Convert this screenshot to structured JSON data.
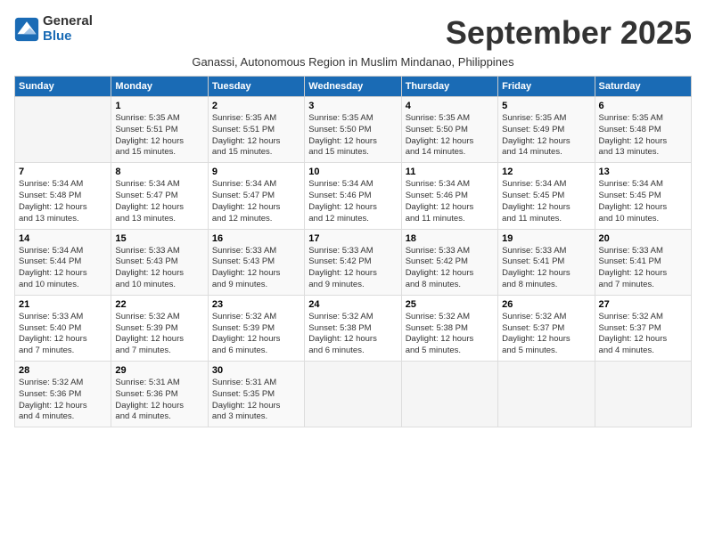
{
  "header": {
    "logo_line1": "General",
    "logo_line2": "Blue",
    "month_title": "September 2025",
    "subtitle": "Ganassi, Autonomous Region in Muslim Mindanao, Philippines"
  },
  "weekdays": [
    "Sunday",
    "Monday",
    "Tuesday",
    "Wednesday",
    "Thursday",
    "Friday",
    "Saturday"
  ],
  "weeks": [
    [
      {
        "day": "",
        "info": ""
      },
      {
        "day": "1",
        "info": "Sunrise: 5:35 AM\nSunset: 5:51 PM\nDaylight: 12 hours\nand 15 minutes."
      },
      {
        "day": "2",
        "info": "Sunrise: 5:35 AM\nSunset: 5:51 PM\nDaylight: 12 hours\nand 15 minutes."
      },
      {
        "day": "3",
        "info": "Sunrise: 5:35 AM\nSunset: 5:50 PM\nDaylight: 12 hours\nand 15 minutes."
      },
      {
        "day": "4",
        "info": "Sunrise: 5:35 AM\nSunset: 5:50 PM\nDaylight: 12 hours\nand 14 minutes."
      },
      {
        "day": "5",
        "info": "Sunrise: 5:35 AM\nSunset: 5:49 PM\nDaylight: 12 hours\nand 14 minutes."
      },
      {
        "day": "6",
        "info": "Sunrise: 5:35 AM\nSunset: 5:48 PM\nDaylight: 12 hours\nand 13 minutes."
      }
    ],
    [
      {
        "day": "7",
        "info": "Sunrise: 5:34 AM\nSunset: 5:48 PM\nDaylight: 12 hours\nand 13 minutes."
      },
      {
        "day": "8",
        "info": "Sunrise: 5:34 AM\nSunset: 5:47 PM\nDaylight: 12 hours\nand 13 minutes."
      },
      {
        "day": "9",
        "info": "Sunrise: 5:34 AM\nSunset: 5:47 PM\nDaylight: 12 hours\nand 12 minutes."
      },
      {
        "day": "10",
        "info": "Sunrise: 5:34 AM\nSunset: 5:46 PM\nDaylight: 12 hours\nand 12 minutes."
      },
      {
        "day": "11",
        "info": "Sunrise: 5:34 AM\nSunset: 5:46 PM\nDaylight: 12 hours\nand 11 minutes."
      },
      {
        "day": "12",
        "info": "Sunrise: 5:34 AM\nSunset: 5:45 PM\nDaylight: 12 hours\nand 11 minutes."
      },
      {
        "day": "13",
        "info": "Sunrise: 5:34 AM\nSunset: 5:45 PM\nDaylight: 12 hours\nand 10 minutes."
      }
    ],
    [
      {
        "day": "14",
        "info": "Sunrise: 5:34 AM\nSunset: 5:44 PM\nDaylight: 12 hours\nand 10 minutes."
      },
      {
        "day": "15",
        "info": "Sunrise: 5:33 AM\nSunset: 5:43 PM\nDaylight: 12 hours\nand 10 minutes."
      },
      {
        "day": "16",
        "info": "Sunrise: 5:33 AM\nSunset: 5:43 PM\nDaylight: 12 hours\nand 9 minutes."
      },
      {
        "day": "17",
        "info": "Sunrise: 5:33 AM\nSunset: 5:42 PM\nDaylight: 12 hours\nand 9 minutes."
      },
      {
        "day": "18",
        "info": "Sunrise: 5:33 AM\nSunset: 5:42 PM\nDaylight: 12 hours\nand 8 minutes."
      },
      {
        "day": "19",
        "info": "Sunrise: 5:33 AM\nSunset: 5:41 PM\nDaylight: 12 hours\nand 8 minutes."
      },
      {
        "day": "20",
        "info": "Sunrise: 5:33 AM\nSunset: 5:41 PM\nDaylight: 12 hours\nand 7 minutes."
      }
    ],
    [
      {
        "day": "21",
        "info": "Sunrise: 5:33 AM\nSunset: 5:40 PM\nDaylight: 12 hours\nand 7 minutes."
      },
      {
        "day": "22",
        "info": "Sunrise: 5:32 AM\nSunset: 5:39 PM\nDaylight: 12 hours\nand 7 minutes."
      },
      {
        "day": "23",
        "info": "Sunrise: 5:32 AM\nSunset: 5:39 PM\nDaylight: 12 hours\nand 6 minutes."
      },
      {
        "day": "24",
        "info": "Sunrise: 5:32 AM\nSunset: 5:38 PM\nDaylight: 12 hours\nand 6 minutes."
      },
      {
        "day": "25",
        "info": "Sunrise: 5:32 AM\nSunset: 5:38 PM\nDaylight: 12 hours\nand 5 minutes."
      },
      {
        "day": "26",
        "info": "Sunrise: 5:32 AM\nSunset: 5:37 PM\nDaylight: 12 hours\nand 5 minutes."
      },
      {
        "day": "27",
        "info": "Sunrise: 5:32 AM\nSunset: 5:37 PM\nDaylight: 12 hours\nand 4 minutes."
      }
    ],
    [
      {
        "day": "28",
        "info": "Sunrise: 5:32 AM\nSunset: 5:36 PM\nDaylight: 12 hours\nand 4 minutes."
      },
      {
        "day": "29",
        "info": "Sunrise: 5:31 AM\nSunset: 5:36 PM\nDaylight: 12 hours\nand 4 minutes."
      },
      {
        "day": "30",
        "info": "Sunrise: 5:31 AM\nSunset: 5:35 PM\nDaylight: 12 hours\nand 3 minutes."
      },
      {
        "day": "",
        "info": ""
      },
      {
        "day": "",
        "info": ""
      },
      {
        "day": "",
        "info": ""
      },
      {
        "day": "",
        "info": ""
      }
    ]
  ]
}
